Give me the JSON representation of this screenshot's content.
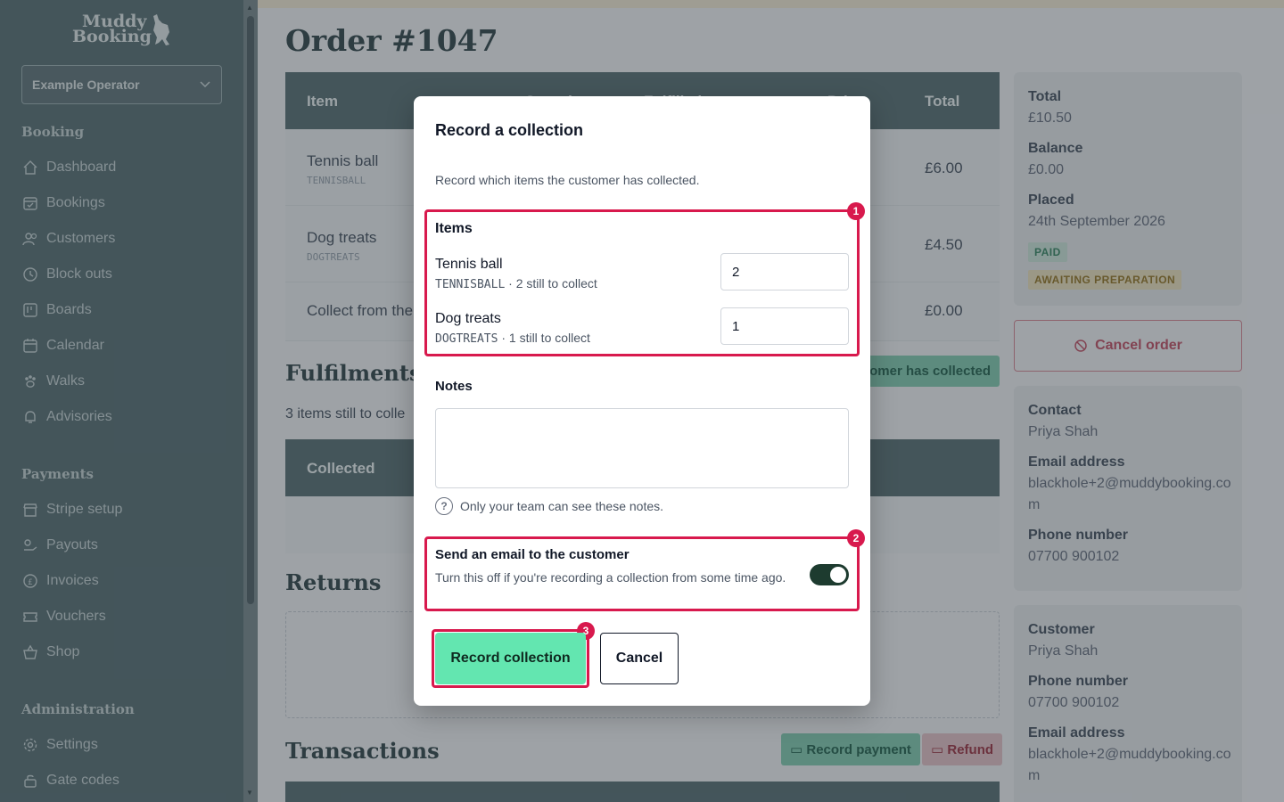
{
  "sidebar": {
    "logo_line1": "Muddy",
    "logo_line2": "Booking",
    "operator": "Example Operator",
    "sections": [
      {
        "title": "Booking",
        "items": [
          {
            "label": "Dashboard",
            "icon": "home-icon"
          },
          {
            "label": "Bookings",
            "icon": "calendar-check-icon"
          },
          {
            "label": "Customers",
            "icon": "users-icon"
          },
          {
            "label": "Block outs",
            "icon": "clock-icon"
          },
          {
            "label": "Boards",
            "icon": "board-icon"
          },
          {
            "label": "Calendar",
            "icon": "calendar-icon"
          },
          {
            "label": "Walks",
            "icon": "paw-icon"
          },
          {
            "label": "Advisories",
            "icon": "bell-icon"
          }
        ]
      },
      {
        "title": "Payments",
        "items": [
          {
            "label": "Stripe setup",
            "icon": "store-icon"
          },
          {
            "label": "Payouts",
            "icon": "payout-icon"
          },
          {
            "label": "Invoices",
            "icon": "pound-icon"
          },
          {
            "label": "Vouchers",
            "icon": "ticket-icon"
          },
          {
            "label": "Shop",
            "icon": "basket-icon"
          }
        ]
      },
      {
        "title": "Administration",
        "items": [
          {
            "label": "Settings",
            "icon": "gear-icon"
          },
          {
            "label": "Gate codes",
            "icon": "lock-icon"
          }
        ]
      }
    ]
  },
  "page": {
    "title": "Order #1047",
    "table": {
      "headers": [
        "Item",
        "Quantity",
        "Fulfilled",
        "Price",
        "Total"
      ],
      "rows": [
        {
          "name": "Tennis ball",
          "sku": "TENNISBALL",
          "total": "£6.00"
        },
        {
          "name": "Dog treats",
          "sku": "DOGTREATS",
          "total": "£4.50"
        },
        {
          "name": "Collect from the",
          "sku": "",
          "total": "£0.00"
        }
      ]
    },
    "fulfilments_title": "Fulfilments",
    "fulfilments_button": "tomer has collected",
    "fulfilments_note": "3 items still to colle",
    "collected_header": "Collected",
    "returns_title": "Returns",
    "transactions_title": "Transactions",
    "record_payment": "Record payment",
    "refund": "Refund"
  },
  "summary": {
    "total_label": "Total",
    "total": "£10.50",
    "balance_label": "Balance",
    "balance": "£0.00",
    "placed_label": "Placed",
    "placed": "24th September 2026",
    "badge_paid": "PAID",
    "badge_status": "AWAITING PREPARATION",
    "cancel_order": "Cancel order",
    "contact_label": "Contact",
    "contact": "Priya Shah",
    "email_label": "Email address",
    "email": "blackhole+2@muddybooking.com",
    "phone_label": "Phone number",
    "phone": "07700 900102",
    "customer_label": "Customer",
    "customer": "Priya Shah",
    "customer_phone_label": "Phone number",
    "customer_phone": "07700 900102",
    "customer_email_label": "Email address",
    "customer_email": "blackhole+2@muddybooking.com"
  },
  "modal": {
    "title": "Record a collection",
    "description": "Record which items the customer has collected.",
    "items_heading": "Items",
    "items": [
      {
        "name": "Tennis ball",
        "sku": "TENNISBALL",
        "remaining": " · 2 still to collect",
        "quantity": "2"
      },
      {
        "name": "Dog treats",
        "sku": "DOGTREATS",
        "remaining": " · 1 still to collect",
        "quantity": "1"
      }
    ],
    "notes_label": "Notes",
    "notes_value": "",
    "notes_help": "Only your team can see these notes.",
    "email_title": "Send an email to the customer",
    "email_desc": "Turn this off if you're recording a collection from some time ago.",
    "email_enabled": true,
    "submit": "Record collection",
    "cancel": "Cancel",
    "markers": [
      "1",
      "2",
      "3"
    ]
  },
  "colors": {
    "sidebar": "#5e7377",
    "accent_green": "#63e6b0",
    "highlight": "#d8194d",
    "toggle_on": "#1d3b2f"
  }
}
